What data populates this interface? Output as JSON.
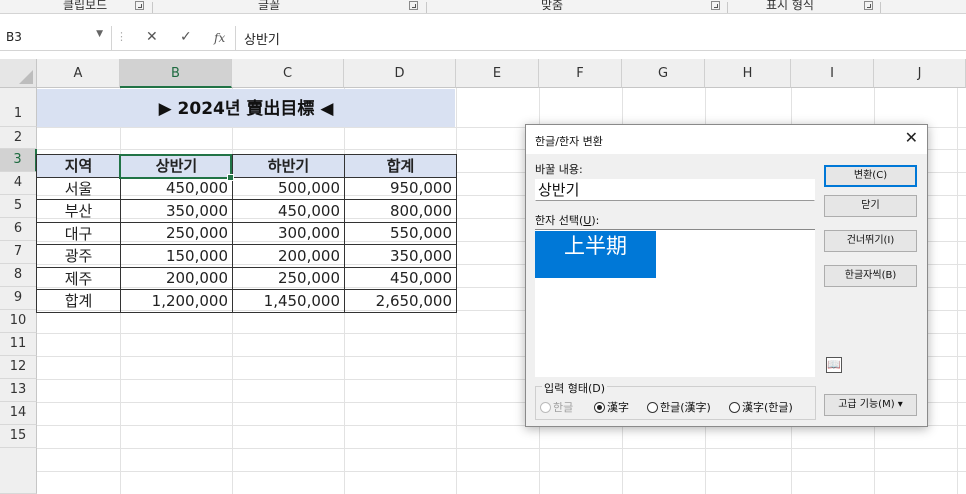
{
  "ribbon": {
    "groups": [
      "클립보드",
      "글꼴",
      "맞춤",
      "표시 형식"
    ]
  },
  "formula_bar": {
    "name_box": "B3",
    "cancel_icon": "✕",
    "enter_icon": "✓",
    "fx_label": "fx",
    "content": "상반기"
  },
  "columns": [
    "A",
    "B",
    "C",
    "D",
    "E",
    "F",
    "G",
    "H",
    "I",
    "J"
  ],
  "rows": [
    "1",
    "2",
    "3",
    "4",
    "5",
    "6",
    "7",
    "8",
    "9",
    "10",
    "11",
    "12",
    "13",
    "14",
    "15"
  ],
  "sheet": {
    "title": "▶ 2024년 賣出目標 ◀",
    "header": [
      "지역",
      "상반기",
      "하반기",
      "합계"
    ],
    "data": [
      [
        "서울",
        "450,000",
        "500,000",
        "950,000"
      ],
      [
        "부산",
        "350,000",
        "450,000",
        "800,000"
      ],
      [
        "대구",
        "250,000",
        "300,000",
        "550,000"
      ],
      [
        "광주",
        "150,000",
        "200,000",
        "350,000"
      ],
      [
        "제주",
        "200,000",
        "250,000",
        "450,000"
      ],
      [
        "합계",
        "1,200,000",
        "1,450,000",
        "2,650,000"
      ]
    ],
    "selected_cell": "B3"
  },
  "dialog": {
    "title": "한글/한자 변환",
    "close_icon": "✕",
    "replace_label": "바꿀 내용:",
    "replace_value": "상반기",
    "hanja_label_pre": "한자 선택(",
    "hanja_label_key": "U",
    "hanja_label_post": "):",
    "hanja_options": [
      "上半期"
    ],
    "buttons": {
      "convert": "변환(C)",
      "close": "닫기",
      "skip": "건너뛰기(I)",
      "dictionary": "한글자씩(B)",
      "advanced": "고급 기능(M) ▾"
    },
    "book_icon": "📖",
    "input_form": {
      "legend": "입력 형태(D)",
      "options": [
        "한글",
        "漢字",
        "한글(漢字)",
        "漢字(한글)"
      ],
      "selected": "漢字"
    }
  }
}
